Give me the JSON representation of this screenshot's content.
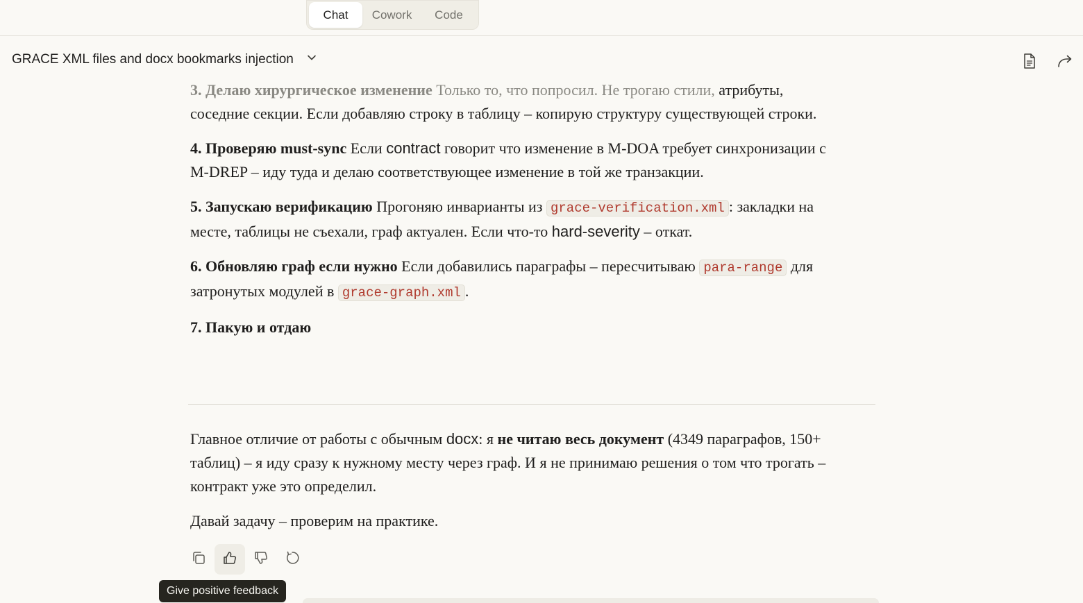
{
  "modes": {
    "chat": "Chat",
    "cowork": "Cowork",
    "code": "Code"
  },
  "header": {
    "title": "GRACE XML files and docx bookmarks injection"
  },
  "steps": {
    "s3": {
      "heading": "3. Делаю хирургическое изменение",
      "text_faded": " Только то, что попросил. Не трогаю стили,",
      "text": " атрибуты, соседние секции. Если добавляю строку в таблицу – копирую структуру существующей строки."
    },
    "s4": {
      "heading": "4. Проверяю must-sync",
      "text_a": " Если ",
      "word_contract": "contract",
      "text_b": " говорит что изменение в M-DOA требует синхронизации с M-DREP – иду туда и делаю соответствующее изменение в той же транзакции."
    },
    "s5": {
      "heading": "5. Запускаю верификацию",
      "text_a": " Прогоняю инварианты из ",
      "code": "grace-verification.xml",
      "text_b": ": закладки на месте, таблицы не съехали, граф актуален. Если что-то ",
      "word_severity": "hard-severity",
      "text_c": " – откат."
    },
    "s6": {
      "heading": "6. Обновляю граф если нужно",
      "text_a": " Если добавились параграфы – пересчитываю ",
      "code1": "para-range",
      "text_b": " для затронутых модулей в ",
      "code2": "grace-graph.xml",
      "text_c": "."
    },
    "s7": {
      "heading": "7. Пакую и отдаю"
    }
  },
  "summary": {
    "text_a": "Главное отличие от работы с обычным ",
    "word_docx": "docx",
    "text_b": ": я ",
    "bold": "не читаю весь документ",
    "text_c": " (4349 параграфов, 150+ таблиц) – я иду сразу к нужному месту через граф. И я не принимаю решения о том что трогать – контракт уже это определил.",
    "closing": "Давай задачу – проверим на практике."
  },
  "actions": {
    "copy_icon": "copy-icon",
    "thumbs_up_icon": "thumbs-up-icon",
    "thumbs_down_icon": "thumbs-down-icon",
    "retry_icon": "retry-icon"
  },
  "tooltip": {
    "text": "Give positive feedback"
  },
  "colors": {
    "background": "#faf9f5",
    "code_text": "#b03a2e",
    "tooltip_bg": "#26251f"
  }
}
